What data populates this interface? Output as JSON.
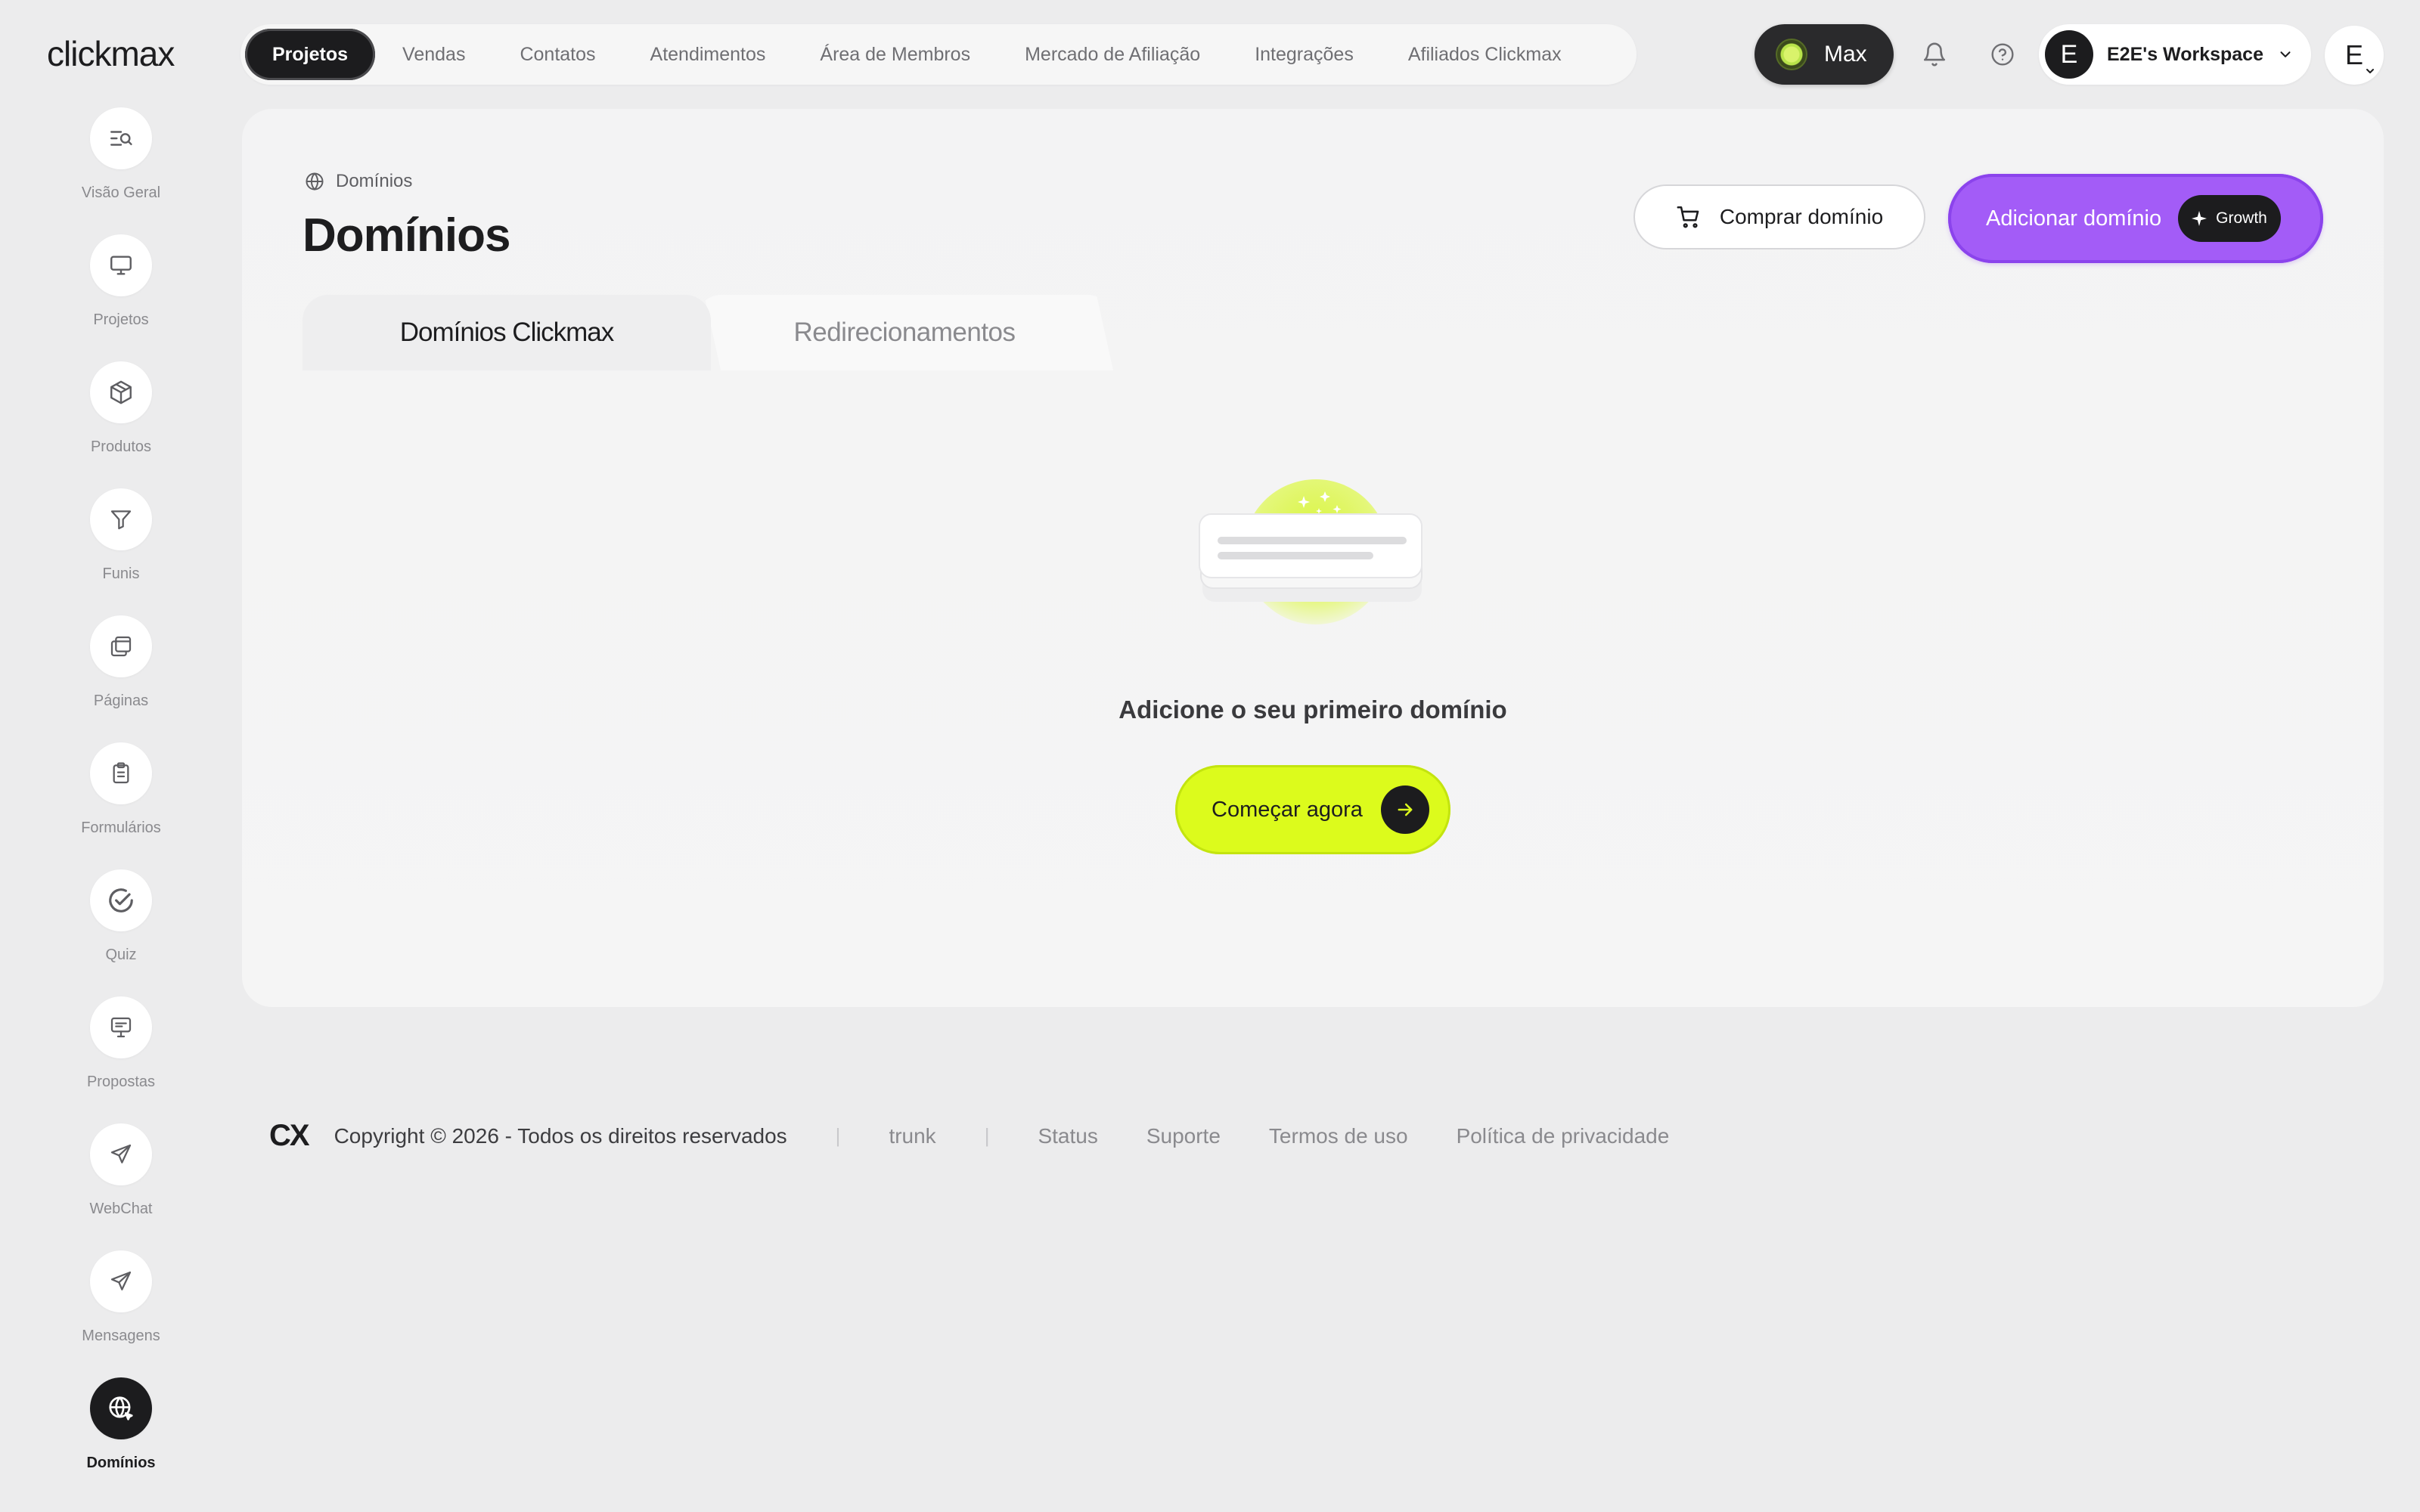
{
  "app": {
    "logo": "clickmax"
  },
  "topnav": {
    "items": [
      "Projetos",
      "Vendas",
      "Contatos",
      "Atendimentos",
      "Área de Membros",
      "Mercado de Afiliação",
      "Integrações",
      "Afiliados Clickmax"
    ],
    "active": "Projetos"
  },
  "header": {
    "plan": "Max",
    "workspace_initial": "E",
    "workspace_name": "E2E's Workspace",
    "user_initial": "E"
  },
  "sidebar": {
    "items": [
      {
        "label": "Visão Geral",
        "icon": "overview-icon"
      },
      {
        "label": "Projetos",
        "icon": "monitor-icon"
      },
      {
        "label": "Produtos",
        "icon": "box-icon"
      },
      {
        "label": "Funis",
        "icon": "funnel-icon"
      },
      {
        "label": "Páginas",
        "icon": "pages-icon"
      },
      {
        "label": "Formulários",
        "icon": "clipboard-icon"
      },
      {
        "label": "Quiz",
        "icon": "check-circle-icon"
      },
      {
        "label": "Propostas",
        "icon": "presentation-icon"
      },
      {
        "label": "WebChat",
        "icon": "send-icon"
      },
      {
        "label": "Mensagens",
        "icon": "send-icon"
      },
      {
        "label": "Domínios",
        "icon": "globe-icon"
      }
    ],
    "active": "Domínios"
  },
  "page": {
    "breadcrumb": "Domínios",
    "title": "Domínios",
    "buy_button": "Comprar domínio",
    "add_button": "Adicionar domínio",
    "add_badge": "Growth",
    "tabs": [
      "Domínios Clickmax",
      "Redirecionamentos"
    ],
    "empty_title": "Adicione o seu primeiro domínio",
    "start_button": "Começar agora"
  },
  "footer": {
    "logo": "CX",
    "copyright": "Copyright © 2026 - Todos os direitos reservados",
    "branch": "trunk",
    "links": [
      "Status",
      "Suporte",
      "Termos de uso",
      "Política de privacidade"
    ]
  },
  "colors": {
    "accent_purple": "#a35cf7",
    "accent_lime": "#dcfb1c",
    "dark": "#1c1c1e",
    "background": "#ececed"
  }
}
